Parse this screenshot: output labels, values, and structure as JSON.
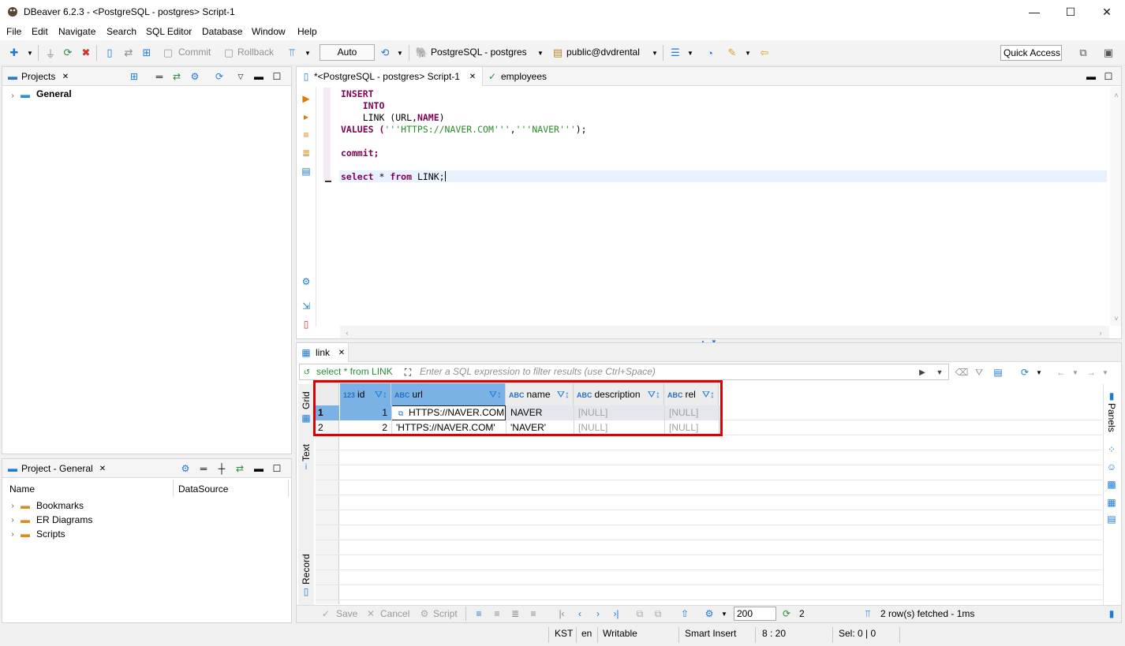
{
  "window": {
    "title": "DBeaver 6.2.3 - <PostgreSQL - postgres> Script-1",
    "min": "—",
    "max": "☐",
    "close": "✕"
  },
  "menu": [
    "File",
    "Edit",
    "Navigate",
    "Search",
    "SQL Editor",
    "Database",
    "Window",
    "Help"
  ],
  "toolbar": {
    "commit": "Commit",
    "rollback": "Rollback",
    "auto": "Auto",
    "connection": "PostgreSQL - postgres",
    "schema": "public@dvdrental",
    "quick_access": "Quick Access"
  },
  "projects_panel": {
    "title": "Projects",
    "items": [
      {
        "label": "General"
      }
    ]
  },
  "project_general_panel": {
    "title": "Project - General",
    "col_name": "Name",
    "col_datasource": "DataSource",
    "items": [
      {
        "label": "Bookmarks"
      },
      {
        "label": "ER Diagrams"
      },
      {
        "label": "Scripts"
      }
    ]
  },
  "editor": {
    "tabs": [
      {
        "label": "*<PostgreSQL - postgres> Script-1"
      },
      {
        "label": "employees"
      }
    ],
    "lines": {
      "l1": "INSERT",
      "l2": "    INTO",
      "l3a": "    LINK (URL,",
      "l3b": "NAME",
      "l3c": ")",
      "l4a": "VALUES (",
      "l4b": "'''HTTPS://NAVER.COM'''",
      "l4c": ",",
      "l4d": "'''NAVER'''",
      "l4e": ");",
      "l6": "commit;",
      "l8a": "select",
      "l8b": " * ",
      "l8c": "from",
      "l8d": " LINK;"
    }
  },
  "results": {
    "tab": "link",
    "query": "select * from LINK",
    "filter_placeholder": "Enter a SQL expression to filter results (use Ctrl+Space)",
    "side_tabs": {
      "grid": "Grid",
      "text": "Text",
      "record": "Record",
      "panels": "Panels"
    },
    "columns": [
      {
        "type": "123",
        "name": "id"
      },
      {
        "type": "ABC",
        "name": "url"
      },
      {
        "type": "ABC",
        "name": "name"
      },
      {
        "type": "ABC",
        "name": "description"
      },
      {
        "type": "ABC",
        "name": "rel"
      }
    ],
    "rows": [
      {
        "num": "1",
        "id": "1",
        "url": "HTTPS://NAVER.COM",
        "name": "NAVER",
        "description": "[NULL]",
        "rel": "[NULL]"
      },
      {
        "num": "2",
        "id": "2",
        "url": "'HTTPS://NAVER.COM'",
        "name": "'NAVER'",
        "description": "[NULL]",
        "rel": "[NULL]"
      }
    ],
    "bottom": {
      "save": "Save",
      "cancel": "Cancel",
      "script": "Script",
      "fetch_size": "200",
      "row_count": "2",
      "status": "2 row(s) fetched - 1ms"
    },
    "highlight_color": "#e00000"
  },
  "statusbar": {
    "timezone": "KST",
    "locale": "en",
    "mode": "Writable",
    "insert": "Smart Insert",
    "position": "8 : 20",
    "selection": "Sel: 0 | 0"
  }
}
